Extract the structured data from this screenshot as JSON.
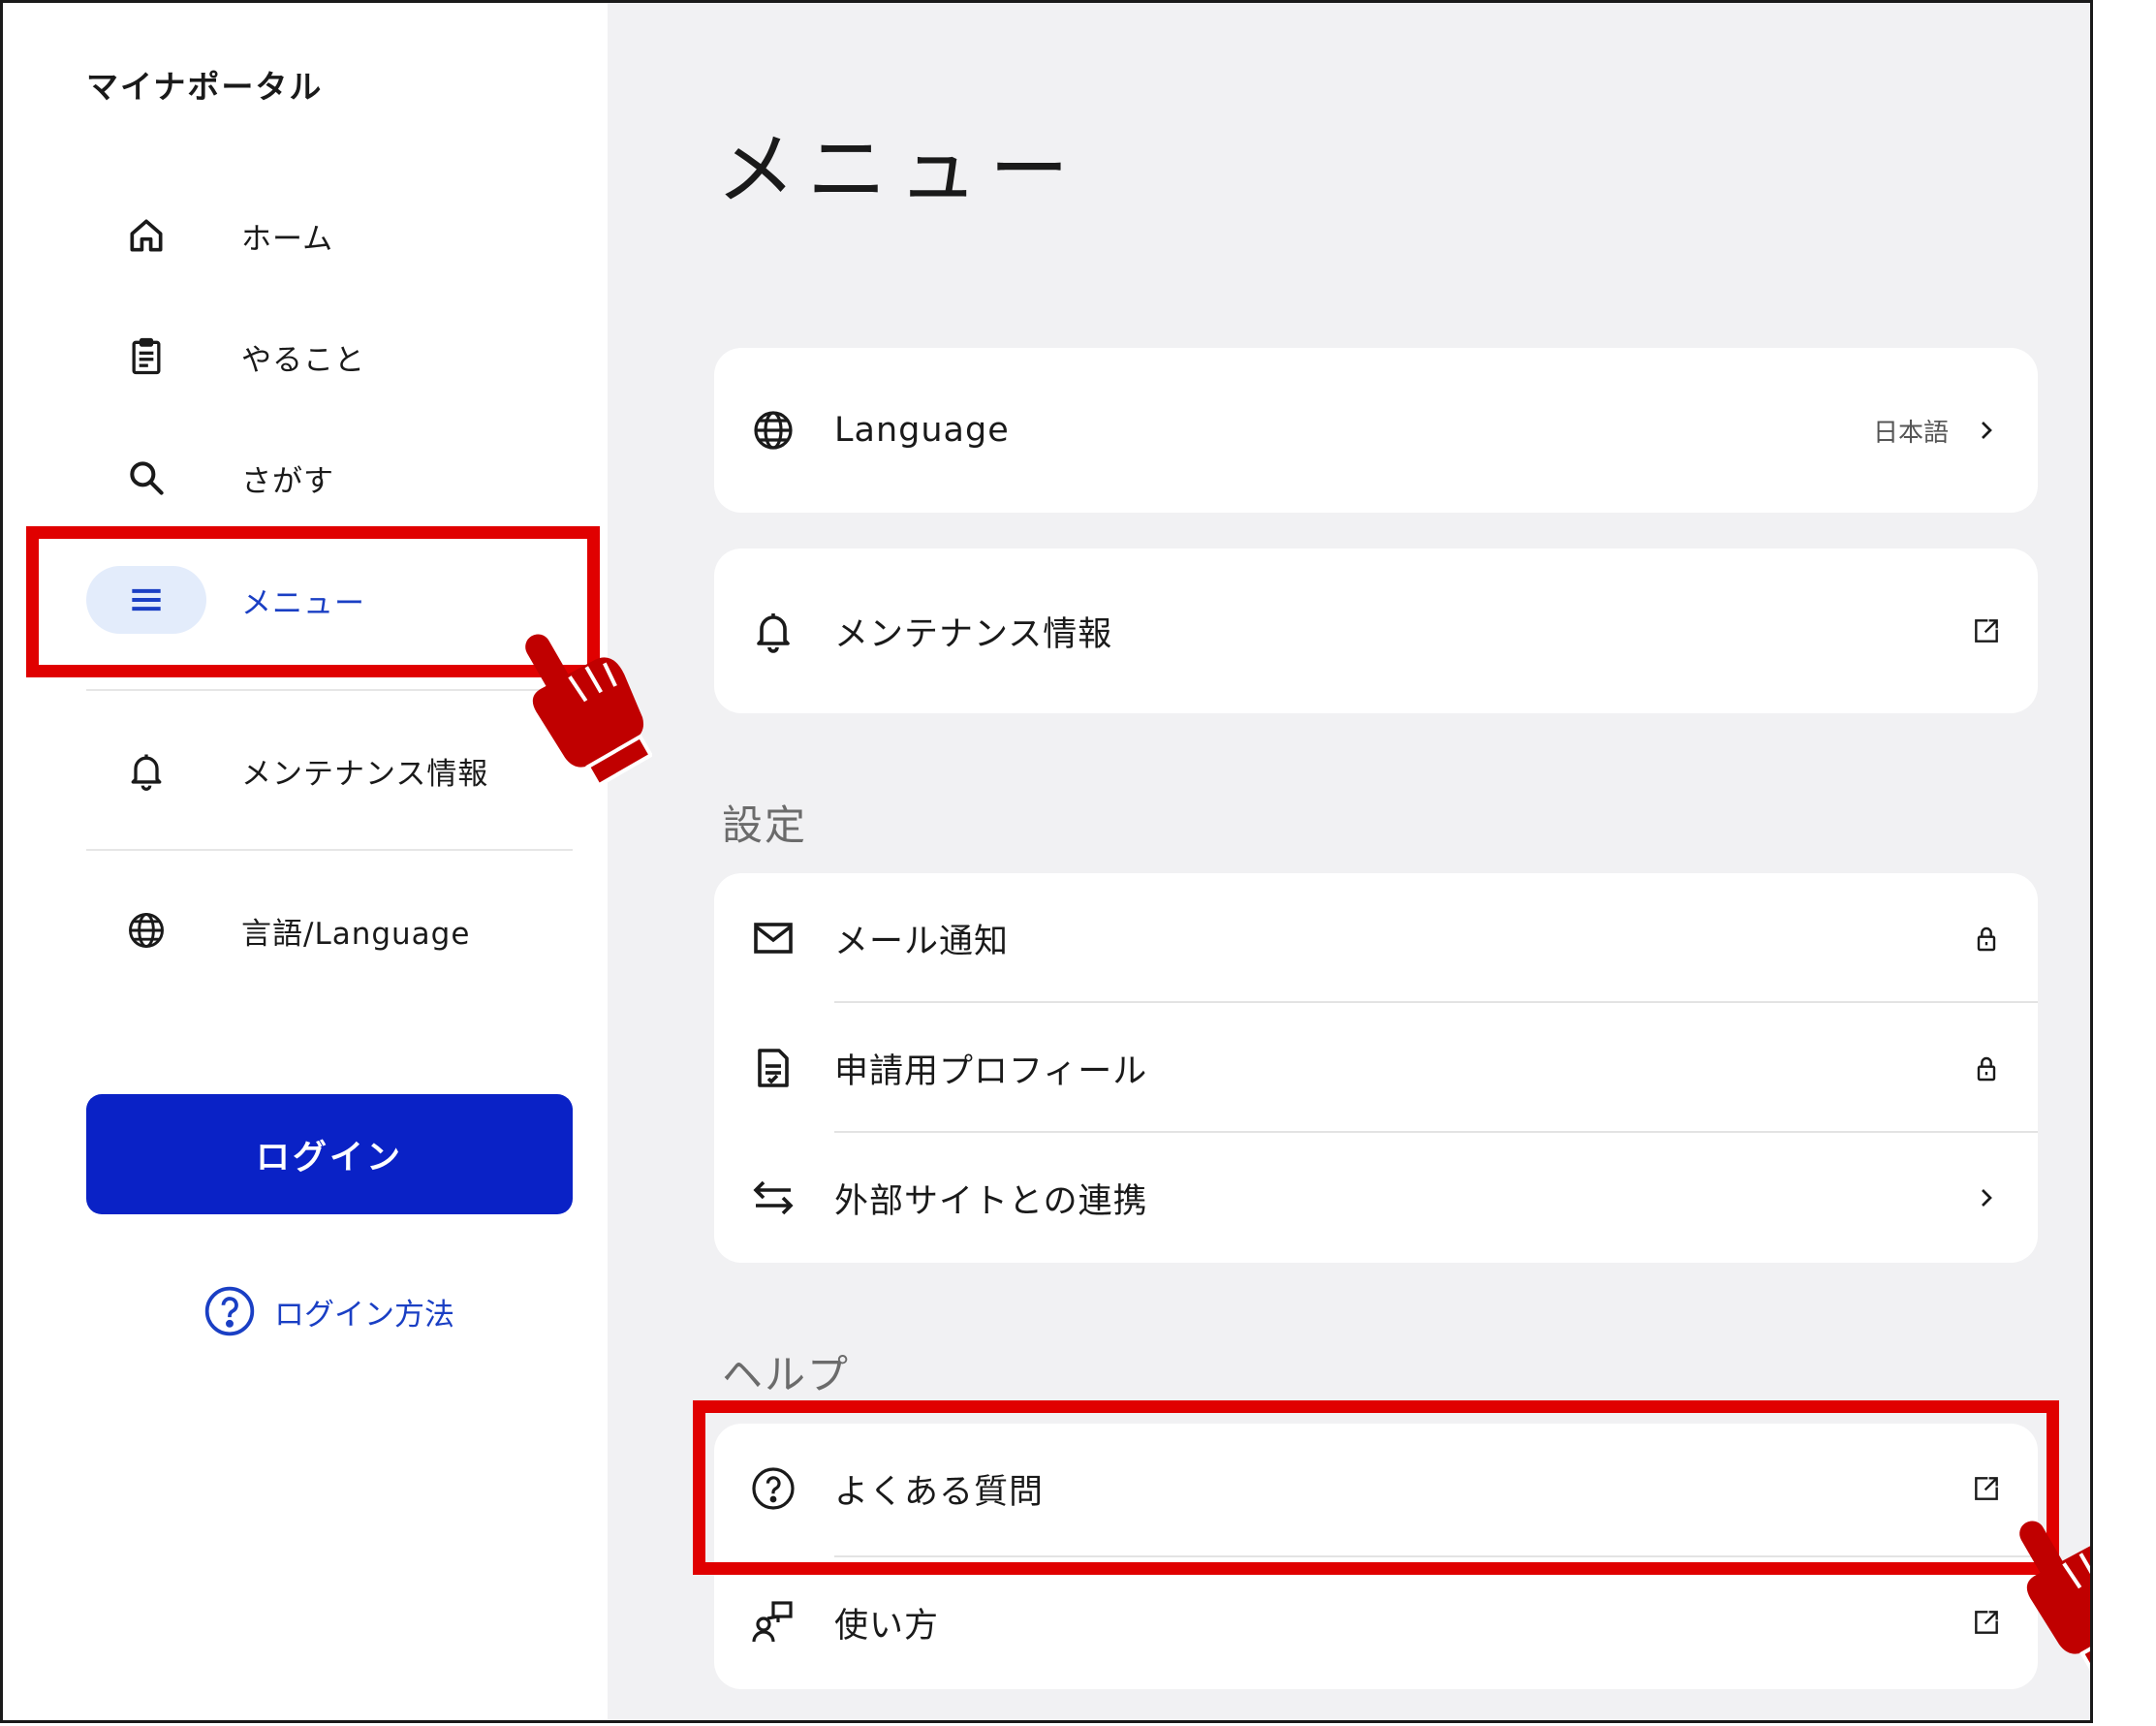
{
  "sidebar": {
    "app_title": "マイナポータル",
    "items": [
      {
        "label": "ホーム",
        "icon": "home-icon"
      },
      {
        "label": "やること",
        "icon": "clipboard-icon"
      },
      {
        "label": "さがす",
        "icon": "search-icon"
      },
      {
        "label": "メニュー",
        "icon": "menu-icon",
        "active": true
      },
      {
        "label": "メンテナンス情報",
        "icon": "bell-icon"
      },
      {
        "label": "言語/Language",
        "icon": "globe-icon"
      }
    ],
    "login_label": "ログイン",
    "login_help_label": "ログイン方法"
  },
  "main": {
    "title": "メニュー",
    "language_row": {
      "label": "Language",
      "value": "日本語",
      "icon": "globe-icon",
      "trail": "chevron-right-icon"
    },
    "maintenance_row": {
      "label": "メンテナンス情報",
      "icon": "bell-icon",
      "trail": "external-link-icon"
    },
    "settings": {
      "title": "設定",
      "rows": [
        {
          "label": "メール通知",
          "icon": "mail-icon",
          "trail": "lock-icon"
        },
        {
          "label": "申請用プロフィール",
          "icon": "document-icon",
          "trail": "lock-icon"
        },
        {
          "label": "外部サイトとの連携",
          "icon": "swap-arrows-icon",
          "trail": "chevron-right-icon"
        }
      ]
    },
    "help": {
      "title": "ヘルプ",
      "rows": [
        {
          "label": "よくある質問",
          "icon": "question-circle-icon",
          "trail": "external-link-icon"
        },
        {
          "label": "使い方",
          "icon": "user-guide-icon",
          "trail": "external-link-icon"
        }
      ]
    }
  },
  "colors": {
    "accent": "#0a22c6",
    "link": "#1a3fc4",
    "highlight": "#e00000",
    "main_bg": "#f1f1f3",
    "pointer_hand": "#c00000"
  }
}
